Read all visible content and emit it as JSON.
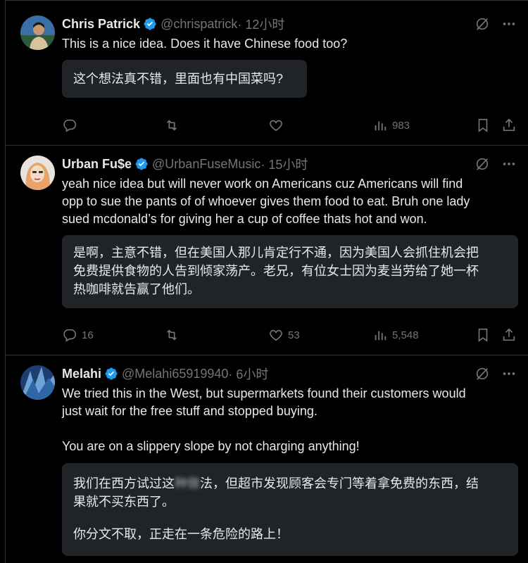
{
  "tweets": [
    {
      "name": "Chris Patrick",
      "handle": "@chrispatrick",
      "time": " · 12小时",
      "text_lines": [
        "This is a nice idea. Does it have Chinese food too?"
      ],
      "translation_lines": [
        "这个想法真不错，里面也有中国菜吗?"
      ],
      "replies": "",
      "retweets": "",
      "likes": "",
      "views": "983"
    },
    {
      "name": "Urban Fu$e",
      "handle": "@UrbanFuseMusic",
      "time": " · 15小时",
      "text_lines": [
        "yeah nice idea but will never work on Americans cuz Americans will find",
        "opp to sue the pants of of whoever gives them food to eat. Bruh one lady",
        "sued mcdonald’s for giving her a cup of coffee thats hot and won."
      ],
      "translation_lines": [
        "是啊，主意不错，但在美国人那儿肯定行不通，因为美国人会抓住机会把",
        "免费提供食物的人告到倾家荡产。老兄，有位女士因为麦当劳给了她一杯",
        "热咖啡就告赢了他们。"
      ],
      "replies": "16",
      "retweets": "",
      "likes": "53",
      "views": "5,548"
    },
    {
      "name": "Melahi",
      "handle": "@Melahi65919940",
      "time": " · 6小时",
      "text_lines": [
        "We tried this in the West, but supermarkets found their customers would",
        "just wait for the free stuff and stopped buying.",
        "",
        "You are on a slippery slope by not charging anything!"
      ],
      "translation_lines": [
        "我们在西方试过这",
        "种做",
        "法，但超市发现顾客会专门等着拿免费的东西，结",
        "果就不买东西了。",
        "",
        "你分文不取，正走在一条危险的路上！"
      ]
    }
  ],
  "colors": {
    "background": "#000000",
    "text": "#e7e9ea",
    "muted": "#71767b",
    "verified": "#1d9bf0",
    "translation_box": "#202327",
    "divider": "#2f3336"
  }
}
